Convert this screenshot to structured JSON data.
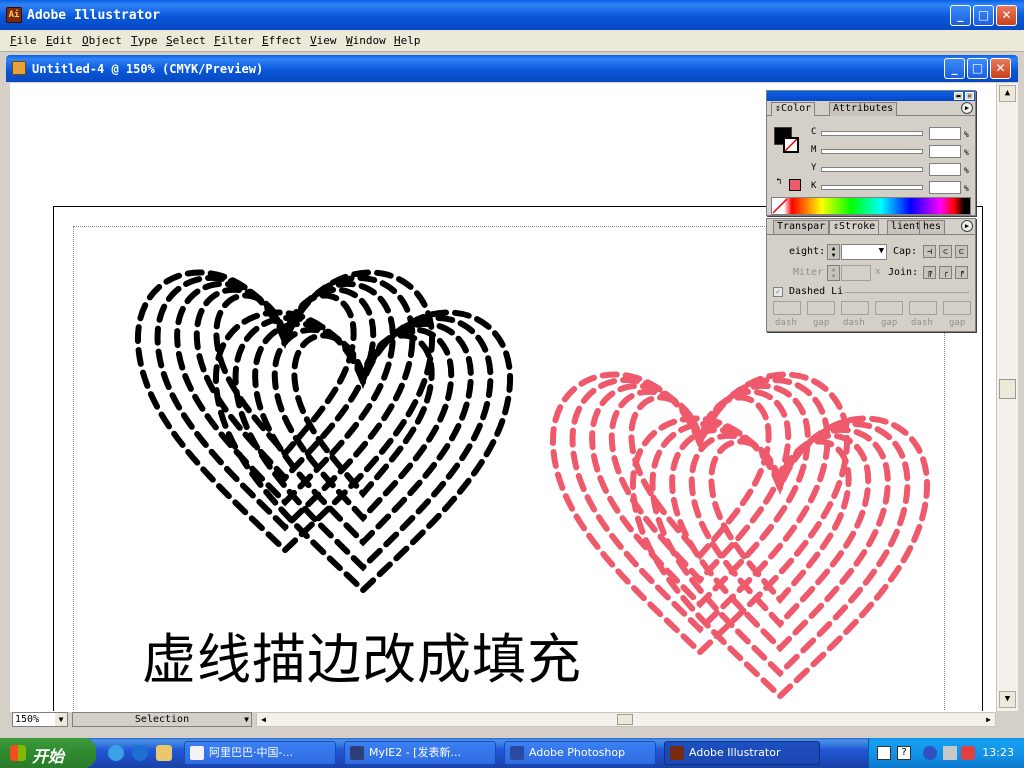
{
  "app": {
    "title": "Adobe Illustrator",
    "icon_text": "Ai",
    "buttons": {
      "minimize": "_",
      "maximize": "□",
      "close": "✕"
    }
  },
  "menu": [
    "File",
    "Edit",
    "Object",
    "Type",
    "Select",
    "Filter",
    "Effect",
    "View",
    "Window",
    "Help"
  ],
  "document": {
    "title": "Untitled-4 @ 150% (CMYK/Preview)"
  },
  "artwork": {
    "caption": "虚线描边改成填充",
    "black_heart_color": "#000000",
    "pink_heart_color": "#ee5a6c"
  },
  "statusbar": {
    "zoom": "150%",
    "tool": "Selection"
  },
  "color_palette": {
    "tabs": [
      "Color",
      "Attributes"
    ],
    "channels": [
      "C",
      "M",
      "Y",
      "K"
    ],
    "percent_sign": "%",
    "fill_color": "#000000",
    "stroke_swatch_color": "#ee5a6c"
  },
  "stroke_palette": {
    "tabs": [
      "Transpar",
      "Stroke",
      "lient",
      "hes"
    ],
    "weight_label": "eight:",
    "cap_label": "Cap:",
    "miter_label": "Miter",
    "miter_x": "x",
    "join_label": "Join:",
    "dashed_label": "Dashed Li",
    "dash_labels": [
      "dash",
      "gap",
      "dash",
      "gap",
      "dash",
      "gap"
    ]
  },
  "taskbar": {
    "start_label": "开始",
    "tasks": [
      {
        "label": "阿里巴巴·中国-...",
        "active": false
      },
      {
        "label": "MyIE2 - [发表新...",
        "active": false
      },
      {
        "label": "Adobe Photoshop",
        "active": false
      },
      {
        "label": "Adobe Illustrator",
        "active": true
      }
    ],
    "clock": "13:23"
  }
}
